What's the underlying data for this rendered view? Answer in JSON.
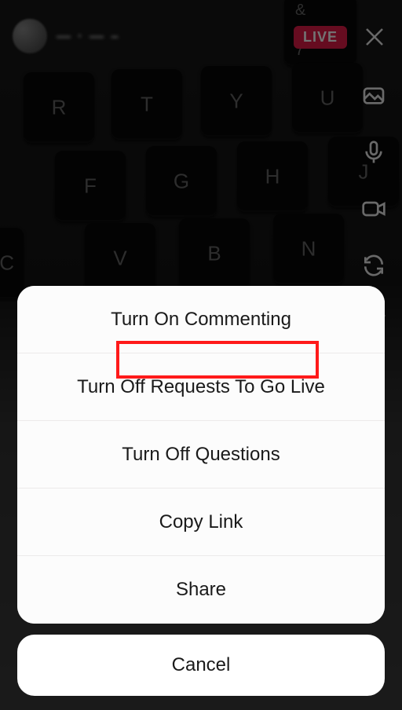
{
  "header": {
    "live_label": "LIVE",
    "username_obscured": "— · — –"
  },
  "side_icons": [
    {
      "name": "gallery-icon"
    },
    {
      "name": "microphone-icon"
    },
    {
      "name": "video-camera-icon"
    },
    {
      "name": "switch-camera-icon"
    },
    {
      "name": "face-filter-icon"
    }
  ],
  "keyboard_keys": {
    "row1": [
      "R",
      "T",
      "Y",
      "U"
    ],
    "row1_symbol": {
      "key": "&",
      "alt": "7"
    },
    "row2": [
      "F",
      "G",
      "H",
      "J"
    ],
    "row3": [
      "C",
      "V",
      "B",
      "N"
    ]
  },
  "action_sheet": {
    "items": [
      "Turn On Commenting",
      "Turn Off Requests To Go Live",
      "Turn Off Questions",
      "Copy Link",
      "Share"
    ],
    "cancel": "Cancel"
  },
  "highlight_index": 0
}
